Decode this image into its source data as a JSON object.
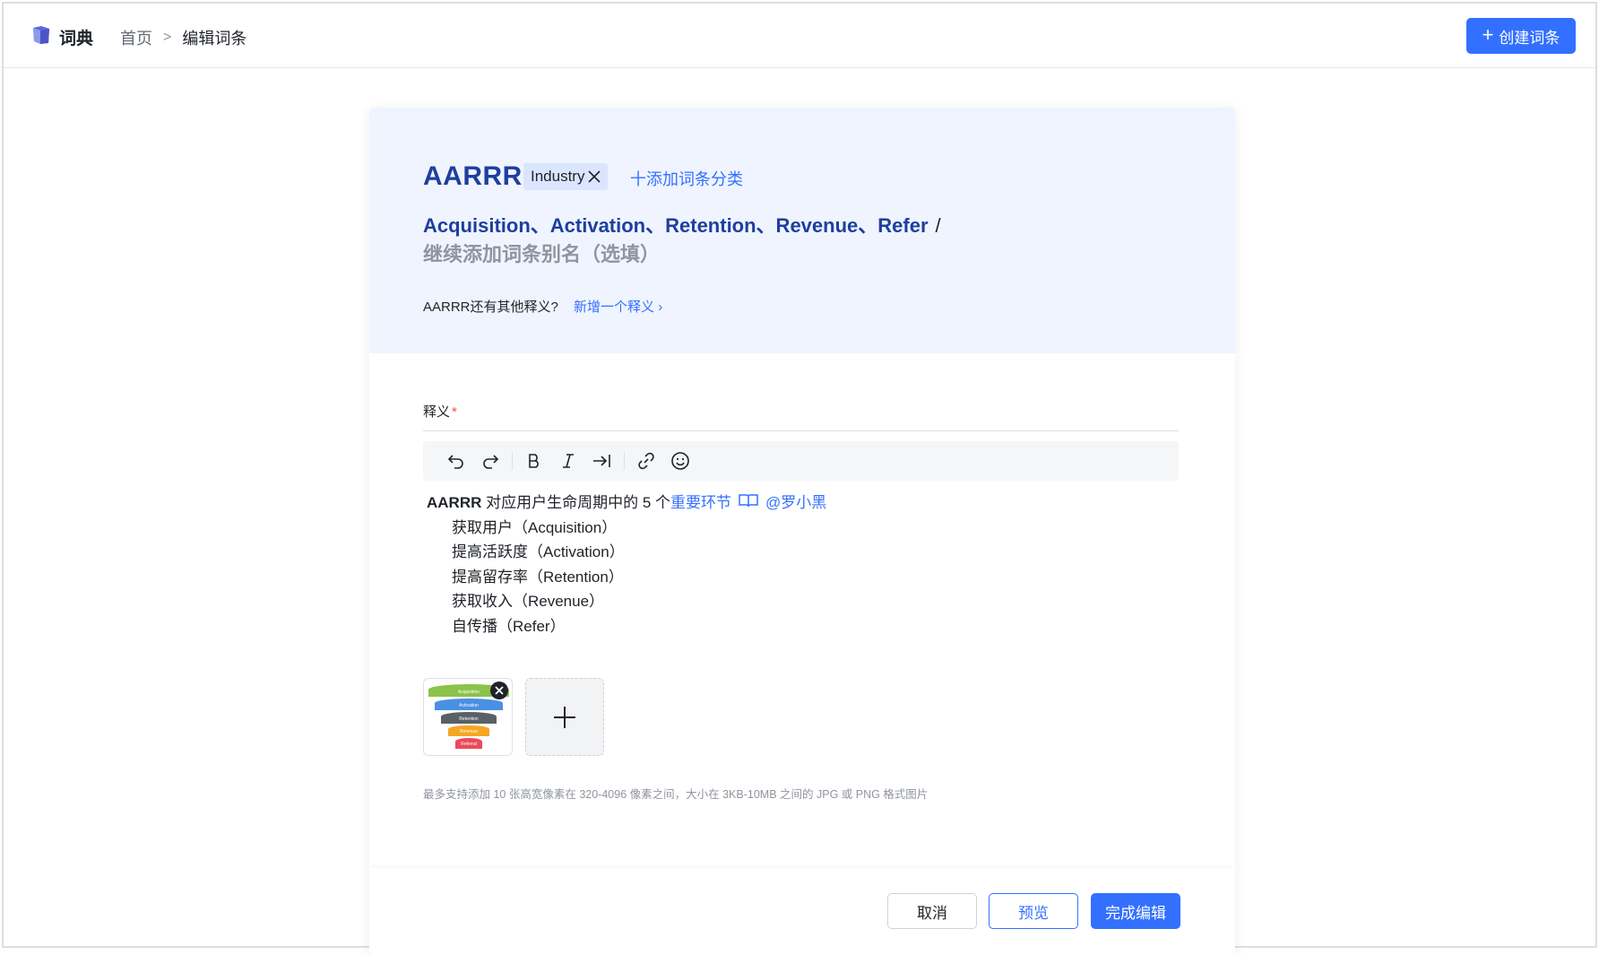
{
  "header": {
    "app_title": "词典",
    "breadcrumb_home": "首页",
    "breadcrumb_sep": ">",
    "breadcrumb_current": "编辑词条",
    "create_button": "创建词条"
  },
  "entry": {
    "term": "AARRR",
    "tag": "Industry",
    "add_category": "十添加词条分类",
    "aliases": "Acquisition、Activation、Retention、Revenue、Refer",
    "alias_separator": "/",
    "alias_placeholder": "继续添加词条别名（选填）",
    "other_meaning_question": "AARRR还有其他释义?",
    "add_meaning_link": "新增一个释义"
  },
  "editor": {
    "label": "释义",
    "required_mark": "*",
    "toolbar": [
      "undo-icon",
      "redo-icon",
      "bold-icon",
      "italic-icon",
      "indent-icon",
      "link-icon",
      "emoji-icon"
    ],
    "lead_bold": "AARRR",
    "lead_text": " 对应用户生命周期中的 5 个",
    "lead_link": "重要环节",
    "mention": "@罗小黑",
    "items": [
      "获取用户（Acquisition）",
      "提高活跃度（Activation）",
      "提高留存率（Retention）",
      "获取收入（Revenue）",
      "自传播（Refer）"
    ]
  },
  "images": {
    "funnel_labels": [
      "Acquisition",
      "Activation",
      "Retention",
      "Revenue",
      "Referral"
    ],
    "funnel_colors": [
      "#8bc34a",
      "#4a90e2",
      "#5a6068",
      "#f5a623",
      "#e94b5a"
    ],
    "hint": "最多支持添加 10 张高宽像素在 320-4096 像素之间，大小在 3KB-10MB 之间的 JPG 或 PNG 格式图片"
  },
  "footer": {
    "cancel": "取消",
    "preview": "预览",
    "done": "完成编辑"
  },
  "colors": {
    "primary": "#3370ff",
    "term": "#1d3f9e",
    "card_top_bg": "#f0f4ff"
  }
}
